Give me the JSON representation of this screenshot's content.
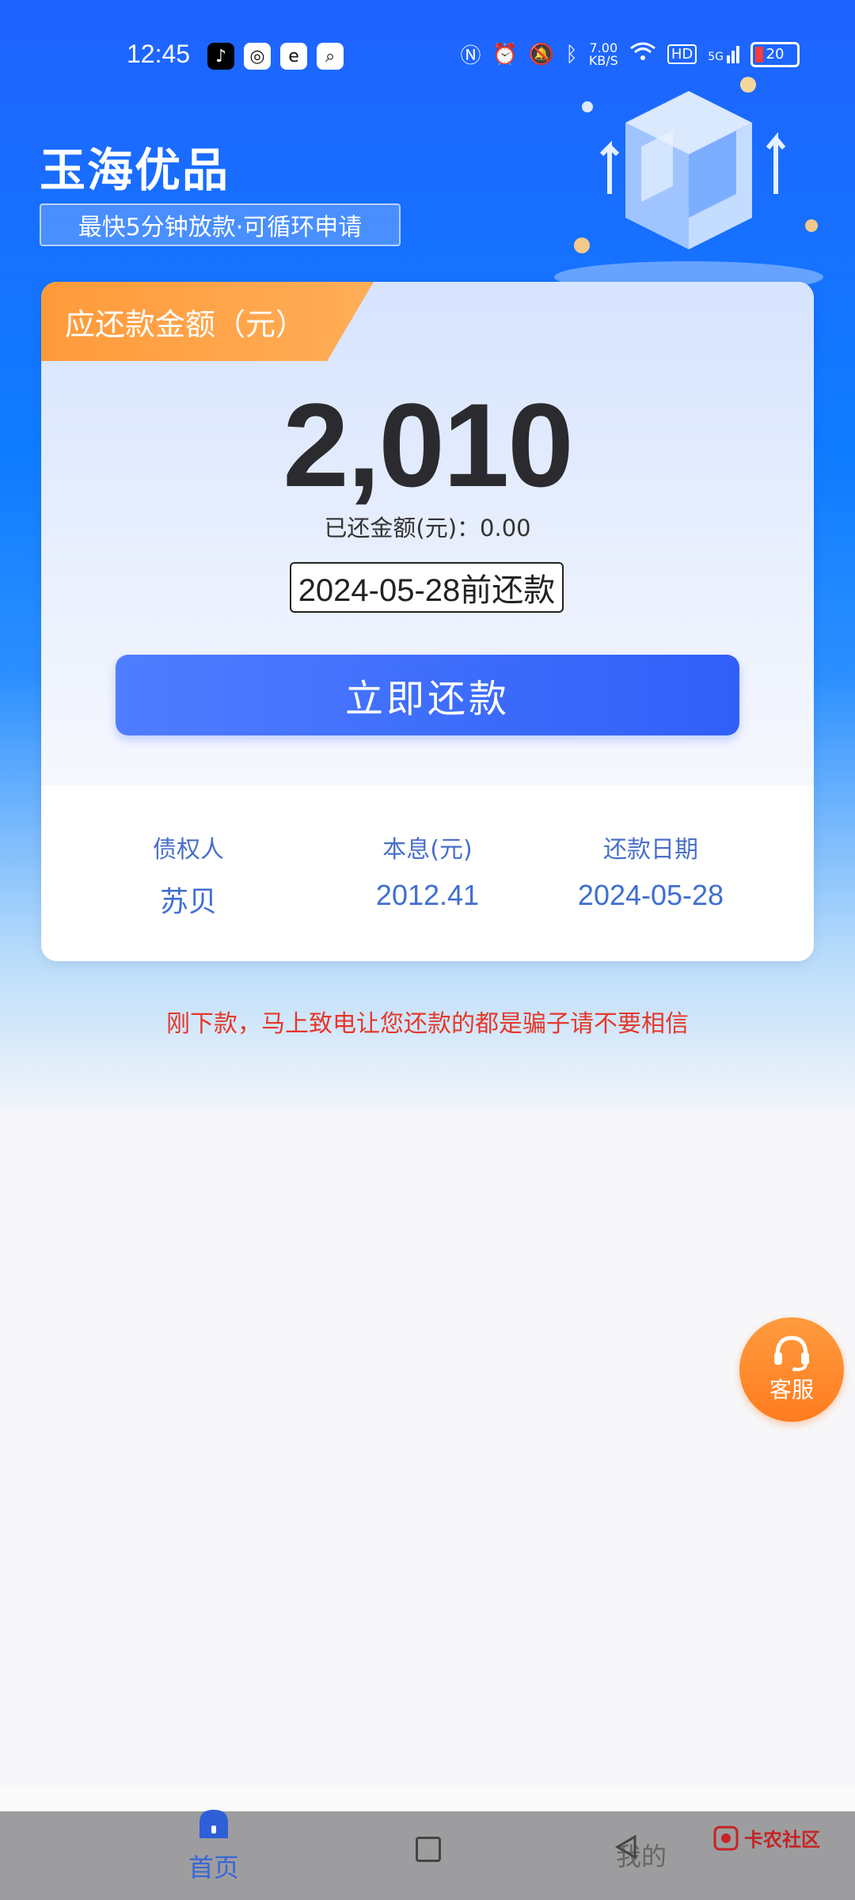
{
  "status_bar": {
    "time": "12:45",
    "net_speed_value": "7.00",
    "net_speed_unit": "KB/S",
    "network": "5G",
    "hd_label": "HD",
    "battery": "20"
  },
  "brand": {
    "name": "玉海优品",
    "tagline": "最快5分钟放款·可循环申请"
  },
  "card": {
    "ribbon_label": "应还款金额（元）",
    "amount": "2,010",
    "paid_label": "已还金额(元)：0.00",
    "due_label": "2024-05-28前还款",
    "pay_button": "立即还款",
    "info": [
      {
        "label": "债权人",
        "value": "苏贝"
      },
      {
        "label": "本息(元)",
        "value": "2012.41"
      },
      {
        "label": "还款日期",
        "value": "2024-05-28"
      }
    ]
  },
  "warning": "刚下款，马上致电让您还款的都是骗子请不要相信",
  "customer_service": "客服",
  "tabs": {
    "home": "首页",
    "mine": "我的"
  },
  "watermark": "卡农社区",
  "colors": {
    "primary": "#2f5ff8",
    "accent_orange": "#ff9a3a",
    "warning_red": "#e6372a"
  }
}
